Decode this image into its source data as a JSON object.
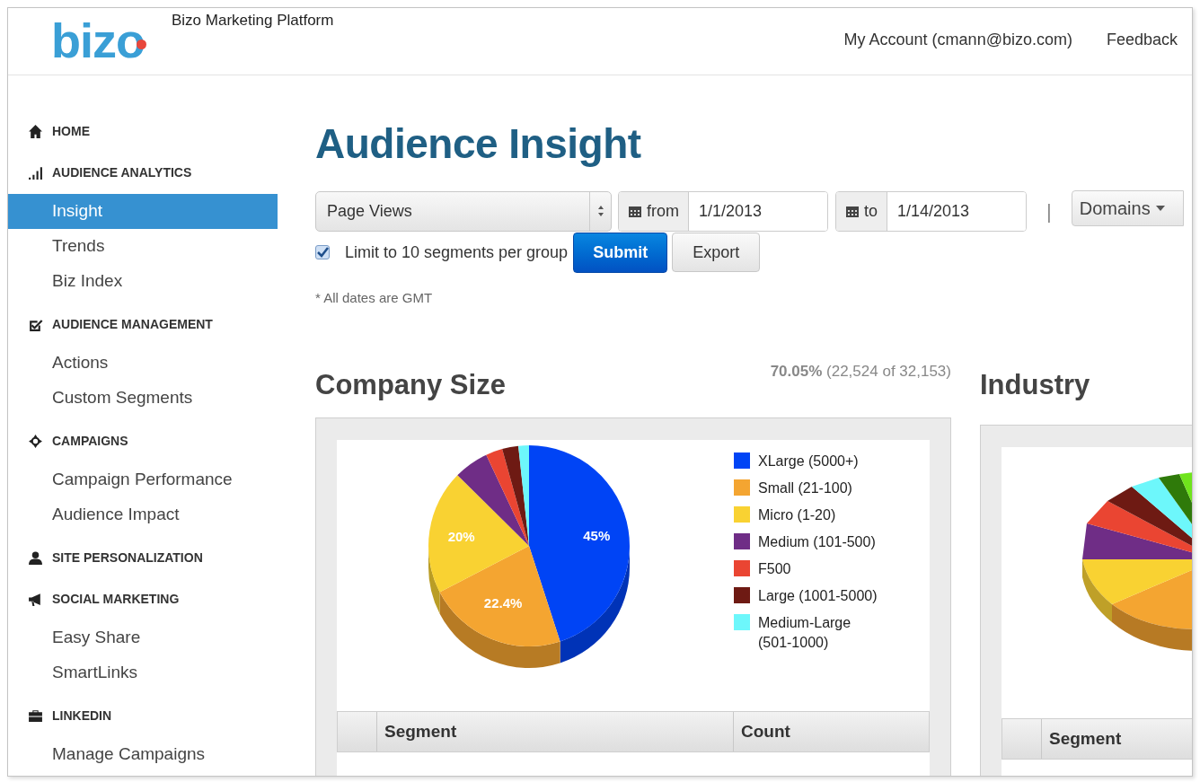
{
  "header": {
    "logo": "bizo",
    "product": "Bizo Marketing Platform",
    "links": [
      "My Account (cmann@bizo.com)",
      "Feedback"
    ]
  },
  "sidebar": {
    "sections": [
      {
        "title": "HOME"
      },
      {
        "title": "AUDIENCE ANALYTICS",
        "items": [
          {
            "label": "Insight",
            "selected": true
          },
          {
            "label": "Trends",
            "selected": false
          },
          {
            "label": "Biz Index",
            "selected": false
          }
        ]
      },
      {
        "title": "AUDIENCE MANAGEMENT",
        "items": [
          {
            "label": "Actions",
            "selected": false
          },
          {
            "label": "Custom Segments",
            "selected": false
          }
        ]
      },
      {
        "title": "CAMPAIGNS",
        "items": [
          {
            "label": "Campaign Performance",
            "selected": false
          },
          {
            "label": "Audience Impact",
            "selected": false
          }
        ]
      },
      {
        "title": "SITE PERSONALIZATION"
      },
      {
        "title": "SOCIAL MARKETING",
        "items": [
          {
            "label": "Easy Share",
            "selected": false
          },
          {
            "label": "SmartLinks",
            "selected": false
          }
        ]
      },
      {
        "title": "LINKEDIN",
        "items": [
          {
            "label": "Manage Campaigns",
            "selected": false
          }
        ]
      }
    ]
  },
  "page_title": "Audience Insight",
  "filters": {
    "metric": "Page Views",
    "from_label": "from",
    "from_value": "1/1/2013",
    "to_label": "to",
    "to_value": "1/14/2013",
    "separator": "|",
    "domains": "Domains"
  },
  "limit": {
    "label": "Limit to 10 segments per group",
    "checked": true
  },
  "buttons": [
    "Submit",
    "Export"
  ],
  "note": "* All dates are GMT",
  "company_size": {
    "stat": "**70.05%** (22,524 of 32,153)",
    "chart_data": {
      "type": "pie",
      "title": "Company Size",
      "legend": "right",
      "categories": [
        "XLarge (5000+)",
        "Small (21-100)",
        "Micro (1-20)",
        "Medium (101-500)",
        "F500",
        "Large (1001-5000)",
        "Medium-Large (501-1000)"
      ],
      "series": [
        {
          "values": [
            45,
            22.4,
            20,
            5.6,
            2.7,
            2.6,
            1.7
          ],
          "colors": [
            "#0044f5",
            "#f4a531",
            "#f9d232",
            "#6f2d86",
            "#ea4532",
            "#6e1a13",
            "#6df7fb"
          ]
        }
      ],
      "value_labels": [
        "45%",
        "22.4%",
        "20%",
        null,
        null,
        null,
        null
      ]
    },
    "columns": [
      "Segment",
      "Count"
    ]
  },
  "industry": {
    "title": "Industry",
    "columns": [
      "Segment"
    ]
  }
}
